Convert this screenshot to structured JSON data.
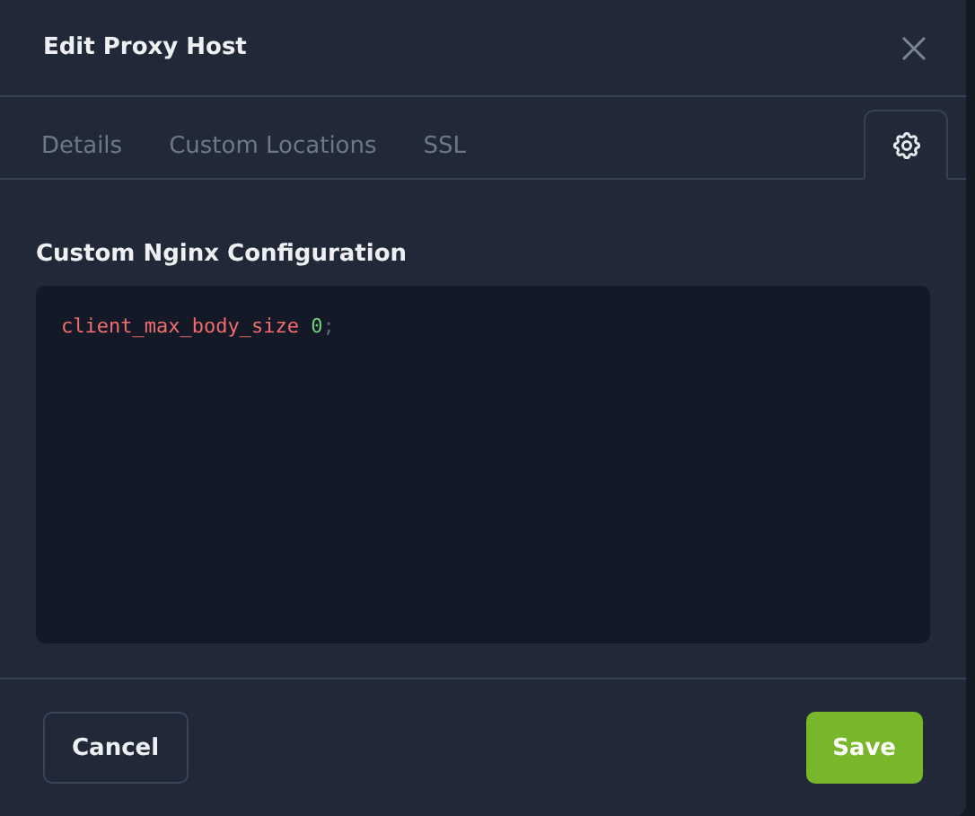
{
  "dialog": {
    "title": "Edit Proxy Host"
  },
  "tabs": [
    {
      "kind": "text",
      "label": "Details",
      "selected": false
    },
    {
      "kind": "text",
      "label": "Custom Locations",
      "selected": false
    },
    {
      "kind": "text",
      "label": "SSL",
      "selected": false
    },
    {
      "kind": "icon",
      "selected": true
    }
  ],
  "section": {
    "title": "Custom Nginx Configuration"
  },
  "editor": {
    "lines": [
      [
        {
          "kind": "property",
          "text": "client_max_body_size"
        },
        {
          "kind": "number",
          "text": "0"
        },
        {
          "kind": "punct",
          "text": ";"
        }
      ]
    ]
  },
  "buttons": [
    {
      "kind": "secondary",
      "label": "Cancel"
    },
    {
      "kind": "primary",
      "label": "Save"
    }
  ]
}
